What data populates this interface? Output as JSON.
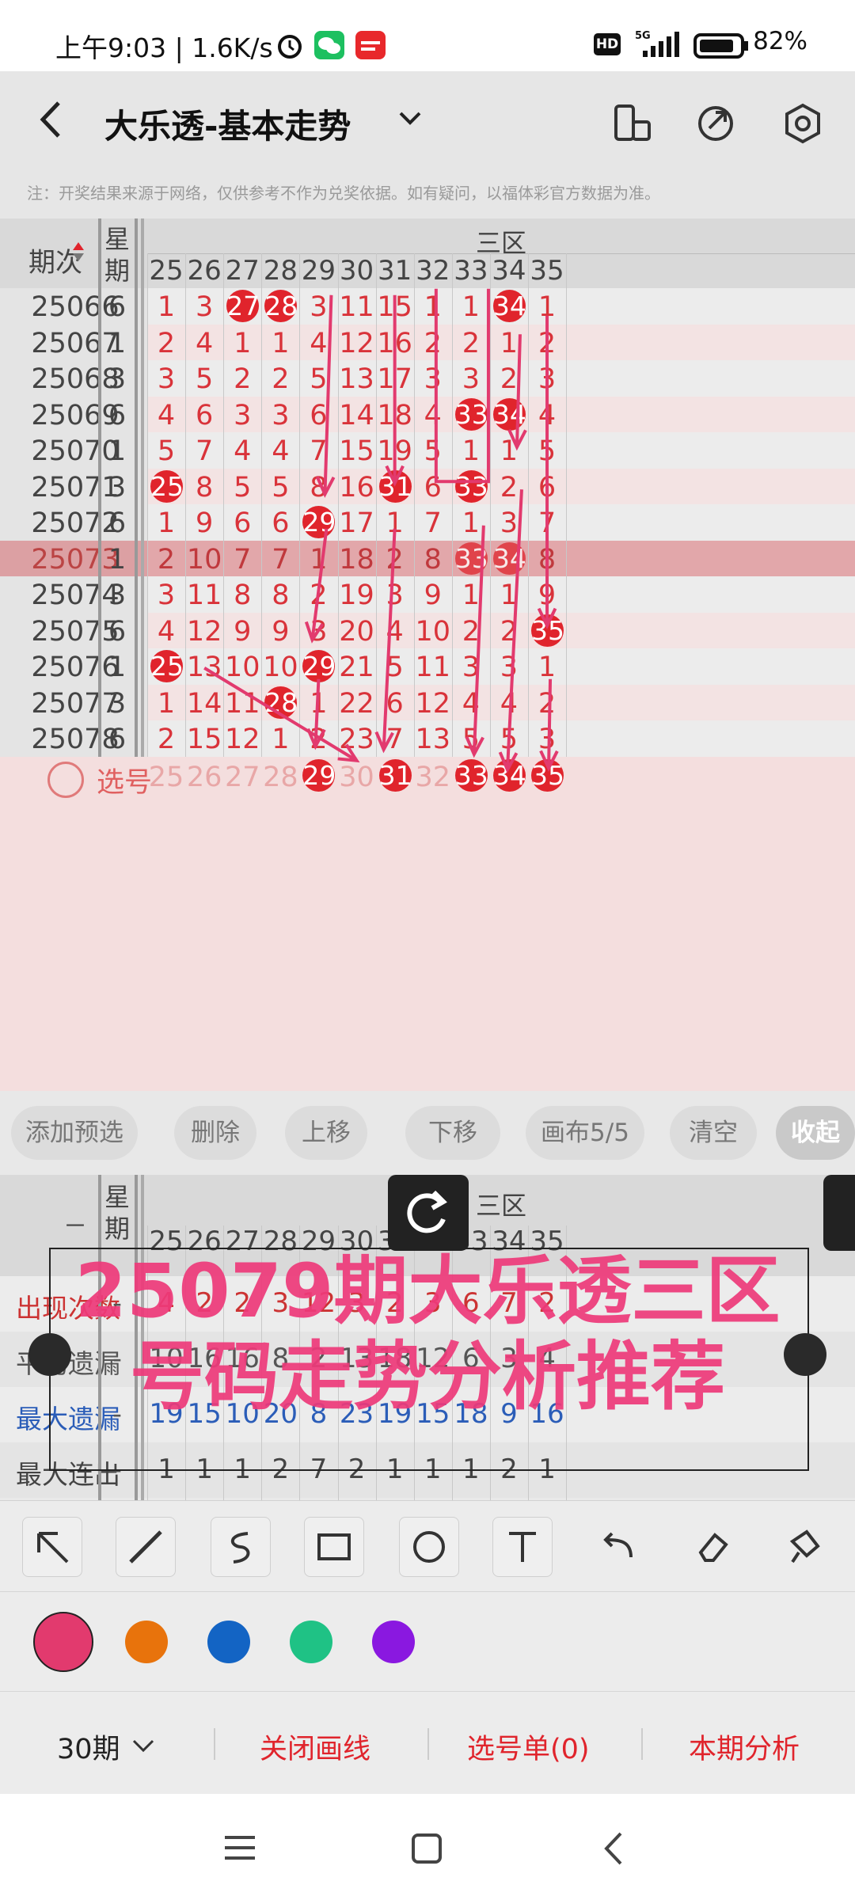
{
  "status": {
    "time_text": "上午9:03 | 1.6K/s",
    "battery": "82%",
    "hd": "HD",
    "signal_label": "5G"
  },
  "header": {
    "title": "大乐透-基本走势"
  },
  "notice": "注：开奖结果来源于网络，仅供参考不作为兑奖依据。如有疑问，以福体彩官方数据为准。",
  "table": {
    "col_period": "期次",
    "col_week": "星期",
    "zone": "三区",
    "numbers": [
      "25",
      "26",
      "27",
      "28",
      "29",
      "30",
      "31",
      "32",
      "33",
      "34",
      "35"
    ],
    "rows": [
      {
        "period": "25066",
        "week": "6",
        "cells": [
          "1",
          "3",
          "27",
          "28",
          "3",
          "11",
          "15",
          "1",
          "1",
          "34",
          "1"
        ]
      },
      {
        "period": "25067",
        "week": "1",
        "cells": [
          "2",
          "4",
          "1",
          "1",
          "4",
          "12",
          "16",
          "2",
          "2",
          "1",
          "2"
        ]
      },
      {
        "period": "25068",
        "week": "3",
        "cells": [
          "3",
          "5",
          "2",
          "2",
          "5",
          "13",
          "17",
          "3",
          "3",
          "2",
          "3"
        ]
      },
      {
        "period": "25069",
        "week": "6",
        "cells": [
          "4",
          "6",
          "3",
          "3",
          "6",
          "14",
          "18",
          "4",
          "33",
          "34",
          "4"
        ]
      },
      {
        "period": "25070",
        "week": "1",
        "cells": [
          "5",
          "7",
          "4",
          "4",
          "7",
          "15",
          "19",
          "5",
          "1",
          "1",
          "5"
        ]
      },
      {
        "period": "25071",
        "week": "3",
        "cells": [
          "25",
          "8",
          "5",
          "5",
          "8",
          "16",
          "31",
          "6",
          "33",
          "2",
          "6"
        ]
      },
      {
        "period": "25072",
        "week": "6",
        "cells": [
          "1",
          "9",
          "6",
          "6",
          "29",
          "17",
          "1",
          "7",
          "1",
          "3",
          "7"
        ]
      },
      {
        "period": "25073",
        "week": "1",
        "cells": [
          "2",
          "10",
          "7",
          "7",
          "1",
          "18",
          "2",
          "8",
          "33",
          "34",
          "8"
        ]
      },
      {
        "period": "25074",
        "week": "3",
        "cells": [
          "3",
          "11",
          "8",
          "8",
          "2",
          "19",
          "3",
          "9",
          "1",
          "1",
          "9"
        ]
      },
      {
        "period": "25075",
        "week": "6",
        "cells": [
          "4",
          "12",
          "9",
          "9",
          "3",
          "20",
          "4",
          "10",
          "2",
          "2",
          "35"
        ]
      },
      {
        "period": "25076",
        "week": "1",
        "cells": [
          "25",
          "13",
          "10",
          "10",
          "29",
          "21",
          "5",
          "11",
          "3",
          "3",
          "1"
        ]
      },
      {
        "period": "25077",
        "week": "3",
        "cells": [
          "1",
          "14",
          "11",
          "28",
          "1",
          "22",
          "6",
          "12",
          "4",
          "4",
          "2"
        ]
      },
      {
        "period": "25078",
        "week": "6",
        "cells": [
          "2",
          "15",
          "12",
          "1",
          "2",
          "23",
          "7",
          "13",
          "5",
          "5",
          "3"
        ]
      }
    ],
    "select_label": "选号",
    "select_balls": [
      "29",
      "31",
      "33",
      "34",
      "35"
    ]
  },
  "actions": [
    "添加预选",
    "删除",
    "上移",
    "下移",
    "画布5/5",
    "清空",
    "收起"
  ],
  "stats": {
    "header_dash": "－",
    "rows": [
      {
        "label": "出现次数",
        "dash": "-",
        "values": [
          "4",
          "2",
          "2",
          "3",
          "12",
          "3",
          "2",
          "3",
          "6",
          "7",
          "2"
        ]
      },
      {
        "label": "平均遗漏",
        "dash": "-",
        "values": [
          "10",
          "16",
          "16",
          "8",
          "2",
          "13",
          "18",
          "12",
          "6",
          "3",
          "4"
        ]
      },
      {
        "label": "最大遗漏",
        "dash": "-",
        "values": [
          "19",
          "15",
          "10",
          "20",
          "8",
          "23",
          "19",
          "15",
          "18",
          "9",
          "16"
        ]
      },
      {
        "label": "最大连出",
        "dash": "-",
        "values": [
          "1",
          "1",
          "1",
          "2",
          "7",
          "2",
          "1",
          "1",
          "1",
          "2",
          "1"
        ]
      }
    ]
  },
  "overlay": {
    "line1": "25079期大乐透三区",
    "line2": "号码走势分析推荐"
  },
  "tools": [
    "arrow-tool",
    "line-tool",
    "freehand-tool",
    "rectangle-tool",
    "circle-tool",
    "text-tool",
    "undo-tool",
    "eraser-tool",
    "clear-brush-tool"
  ],
  "colors": [
    "#e23a6e",
    "#e8730c",
    "#1364c4",
    "#1fc285",
    "#8a18e0"
  ],
  "bottom": {
    "periods": "30期",
    "toggle_lines": "关闭画线",
    "selection": "选号单(0)",
    "analysis": "本期分析"
  },
  "accent": "#e0242c"
}
